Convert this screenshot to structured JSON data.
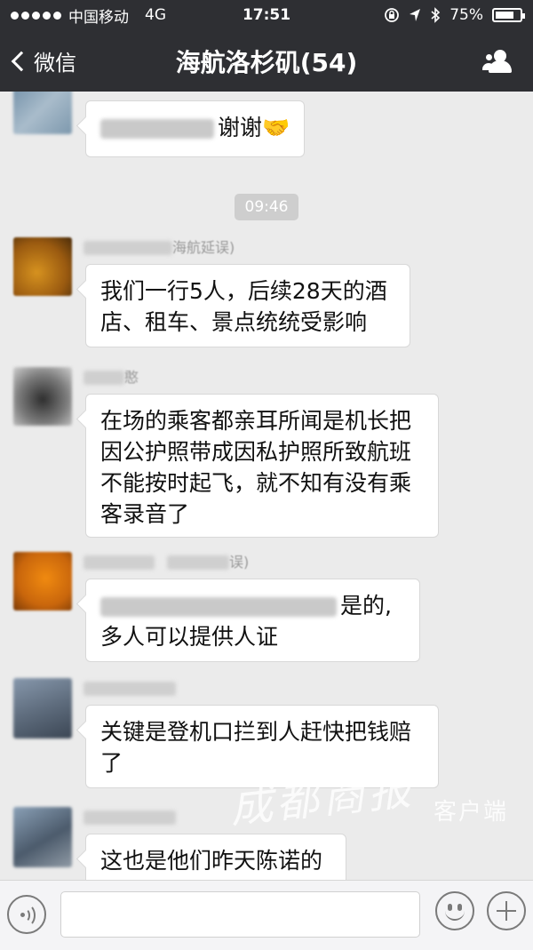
{
  "status_bar": {
    "carrier": "中国移动",
    "network": "4G",
    "time": "17:51",
    "lock_icon": "rotation-lock-icon",
    "location_icon": "location-arrow-icon",
    "bluetooth_icon": "bluetooth-icon",
    "battery": "75%",
    "battery_level": 0.75
  },
  "nav": {
    "back_label": "微信",
    "title": "海航洛杉矶(54)",
    "members_icon": "group-members-icon",
    "bar_color": "#2e2f33"
  },
  "chat": {
    "background": "#ebebeb",
    "time_separator": "09:46",
    "messages": [
      {
        "id": "m0",
        "sender_suffix": "",
        "text": "谢谢🤝"
      },
      {
        "id": "m1",
        "sender_suffix": "海航延误)",
        "text_lines": [
          "我们一行5人，后续28天的酒",
          "店、租车、景点统统受影响"
        ]
      },
      {
        "id": "m2",
        "sender_suffix": "憨",
        "text_lines": [
          "在场的乘客都亲耳所闻是机长把",
          "因公护照带成因私护照所致航班",
          "不能按时起飞，就不知有没有乘",
          "客录音了"
        ]
      },
      {
        "id": "m3",
        "sender_suffix": "误)",
        "text_lines": [
          "是的,",
          "多人可以提供人证"
        ]
      },
      {
        "id": "m4",
        "sender_suffix": "",
        "text_lines": [
          "关键是登机口拦到人赶快把钱赔",
          "了"
        ]
      },
      {
        "id": "m5",
        "sender_suffix": "",
        "text_lines": [
          "这也是他们昨天陈诺的"
        ]
      }
    ]
  },
  "watermark": {
    "main": "成都商报",
    "sub": "客户端"
  },
  "input_bar": {
    "voice_icon": "voice-input-icon",
    "emoji_icon": "emoji-smiley-icon",
    "more_icon": "plus-more-icon",
    "text_value": ""
  }
}
